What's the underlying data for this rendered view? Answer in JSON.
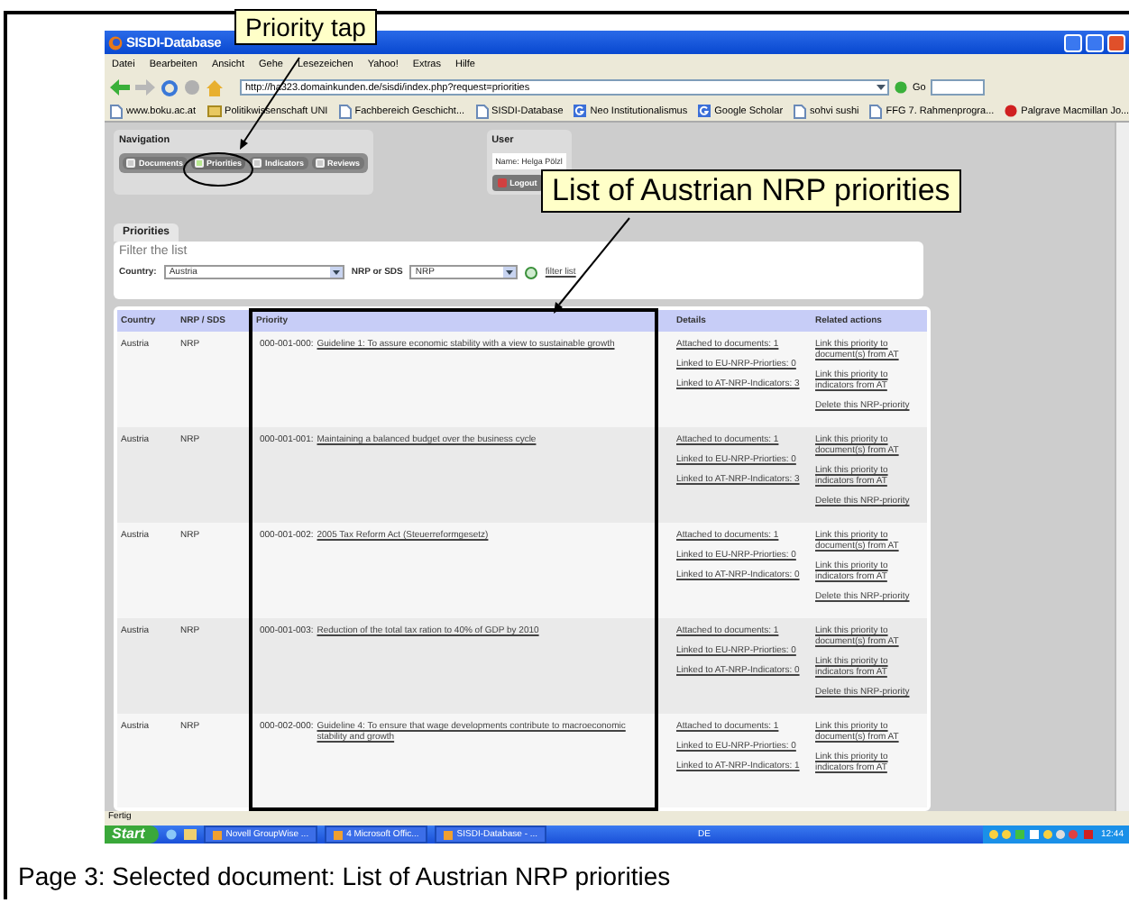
{
  "callouts": [
    {
      "text": "Priority tap"
    },
    {
      "text": "List of Austrian NRP priorities"
    }
  ],
  "window": {
    "title": "SISDI-Database"
  },
  "menu": [
    "Datei",
    "Bearbeiten",
    "Ansicht",
    "Gehe",
    "Lesezeichen",
    "Yahoo!",
    "Extras",
    "Hilfe"
  ],
  "address": {
    "url": "http://ha323.domainkunden.de/sisdi/index.php?request=priorities",
    "go": "Go"
  },
  "bookmarks": [
    {
      "label": "www.boku.ac.at",
      "kind": "page"
    },
    {
      "label": "Politikwissenschaft UNI",
      "kind": "folder"
    },
    {
      "label": "Fachbereich Geschicht...",
      "kind": "page"
    },
    {
      "label": "SISDI-Database",
      "kind": "page"
    },
    {
      "label": "Neo Institutionalismus",
      "kind": "google"
    },
    {
      "label": "Google Scholar",
      "kind": "google"
    },
    {
      "label": "sohvi sushi",
      "kind": "page"
    },
    {
      "label": "FFG 7. Rahmenprogra...",
      "kind": "page"
    },
    {
      "label": "Palgrave Macmillan Jo...",
      "kind": "red"
    }
  ],
  "navigation": {
    "title": "Navigation",
    "items": [
      {
        "label": "Documents",
        "selected": false
      },
      {
        "label": "Priorities",
        "selected": true
      },
      {
        "label": "Indicators",
        "selected": false
      },
      {
        "label": "Reviews",
        "selected": false
      }
    ]
  },
  "user": {
    "title": "User",
    "name": "Name: Helga Pölzl",
    "logout": "Logout"
  },
  "tab": {
    "label": "Priorities"
  },
  "filter": {
    "heading": "Filter the list",
    "fields": [
      {
        "label": "Country:",
        "value": "Austria"
      },
      {
        "label": "NRP or SDS",
        "value": "NRP"
      }
    ],
    "link": "filter list"
  },
  "table": {
    "columns": [
      "Country",
      "NRP / SDS",
      "Priority",
      "Details",
      "Related actions"
    ],
    "rows": [
      {
        "country": "Austria",
        "type": "NRP",
        "code": "000-001-000:",
        "title": "Guideline 1: To assure economic stability with a view to sustainable growth",
        "details": [
          "Attached to documents: 1",
          "Linked to EU-NRP-Priorties: 0",
          "Linked to AT-NRP-Indicators: 3"
        ],
        "actions": [
          "Link this priority to document(s) from AT",
          "Link this priority to indicators from AT",
          "Delete this NRP-priority"
        ]
      },
      {
        "country": "Austria",
        "type": "NRP",
        "code": "000-001-001:",
        "title": "Maintaining a balanced budget over the business cycle",
        "details": [
          "Attached to documents: 1",
          "Linked to EU-NRP-Priorties: 0",
          "Linked to AT-NRP-Indicators: 3"
        ],
        "actions": [
          "Link this priority to document(s) from AT",
          "Link this priority to indicators from AT",
          "Delete this NRP-priority"
        ]
      },
      {
        "country": "Austria",
        "type": "NRP",
        "code": "000-001-002:",
        "title": "2005 Tax Reform Act (Steuerreformgesetz)",
        "details": [
          "Attached to documents: 1",
          "Linked to EU-NRP-Priorties: 0",
          "Linked to AT-NRP-Indicators: 0"
        ],
        "actions": [
          "Link this priority to document(s) from AT",
          "Link this priority to indicators from AT",
          "Delete this NRP-priority"
        ]
      },
      {
        "country": "Austria",
        "type": "NRP",
        "code": "000-001-003:",
        "title": "Reduction of the total tax ration to 40% of GDP by 2010",
        "details": [
          "Attached to documents: 1",
          "Linked to EU-NRP-Priorties: 0",
          "Linked to AT-NRP-Indicators: 0"
        ],
        "actions": [
          "Link this priority to document(s) from AT",
          "Link this priority to indicators from AT",
          "Delete this NRP-priority"
        ]
      },
      {
        "country": "Austria",
        "type": "NRP",
        "code": "000-002-000:",
        "title": "Guideline 4: To ensure that wage developments contribute to macroeconomic stability and growth",
        "details": [
          "Attached to documents: 1",
          "Linked to EU-NRP-Priorties: 0",
          "Linked to AT-NRP-Indicators: 1"
        ],
        "actions": [
          "Link this priority to document(s) from AT",
          "Link this priority to indicators from AT"
        ]
      }
    ]
  },
  "status_bar": "Fertig",
  "taskbar": {
    "start": "Start",
    "tasks": [
      "Novell GroupWise ...",
      "4 Microsoft Offic...",
      "SISDI-Database - ..."
    ],
    "language": "DE",
    "clock": "12:44"
  },
  "caption": "Page 3: Selected document: List of Austrian NRP priorities"
}
